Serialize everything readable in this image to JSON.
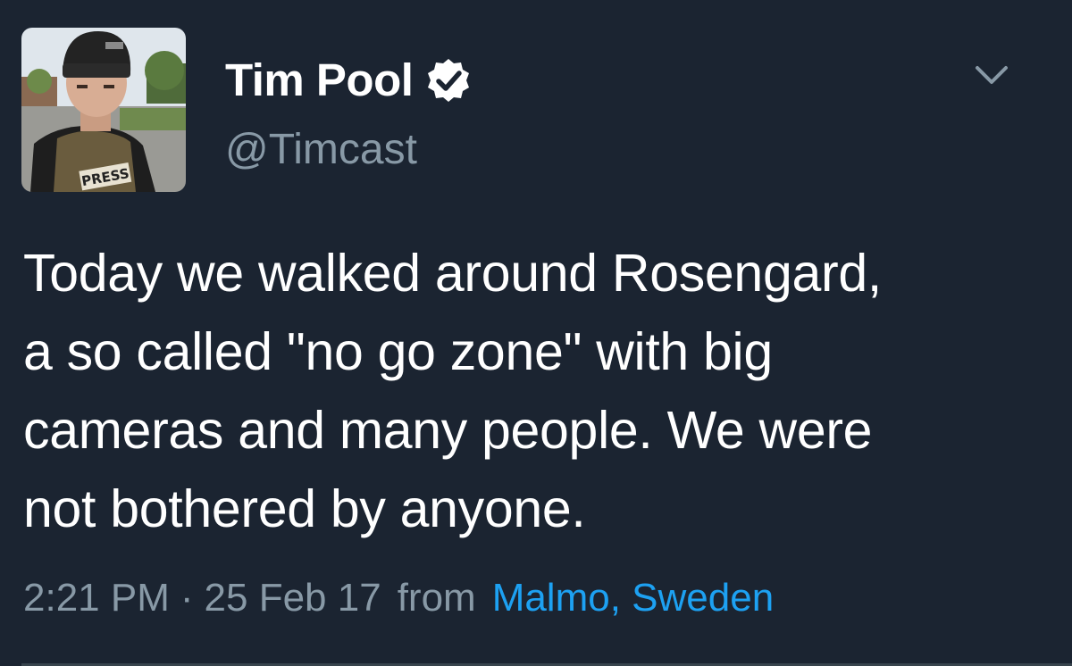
{
  "user": {
    "display_name": "Tim Pool",
    "handle": "@Timcast",
    "avatar_badge_text": "PRESS"
  },
  "tweet": {
    "lines": [
      "Today we walked around Rosengard,",
      "a so called \"no go zone\" with big",
      "cameras and many people. We were",
      "not bothered by anyone."
    ],
    "time": "2:21 PM",
    "separator": "·",
    "date": "25 Feb 17",
    "from_label": "from",
    "location": "Malmo, Sweden"
  },
  "icons": {
    "verified": "verified-badge-icon",
    "menu": "chevron-down-icon"
  },
  "colors": {
    "background": "#1b2431",
    "text": "#ffffff",
    "muted": "#8899a6",
    "link": "#1da1f2"
  }
}
